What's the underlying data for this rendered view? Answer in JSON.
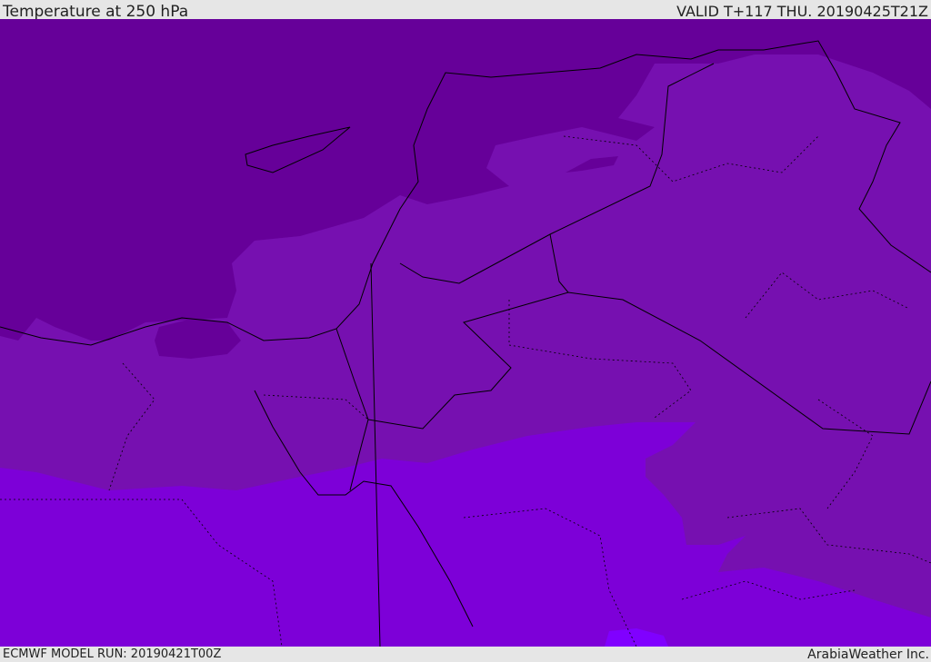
{
  "header": {
    "title": "Temperature at 250 hPa",
    "valid": "VALID T+117 THU. 20190425T21Z"
  },
  "footer": {
    "model_run": "ECMWF MODEL RUN: 20190421T00Z",
    "brand": "ArabiaWeather Inc."
  },
  "colors": {
    "cold": "#660099",
    "mid": "#7610b0",
    "warm": "#7d00d8",
    "warmest": "#8000ff",
    "border": "#000000"
  }
}
